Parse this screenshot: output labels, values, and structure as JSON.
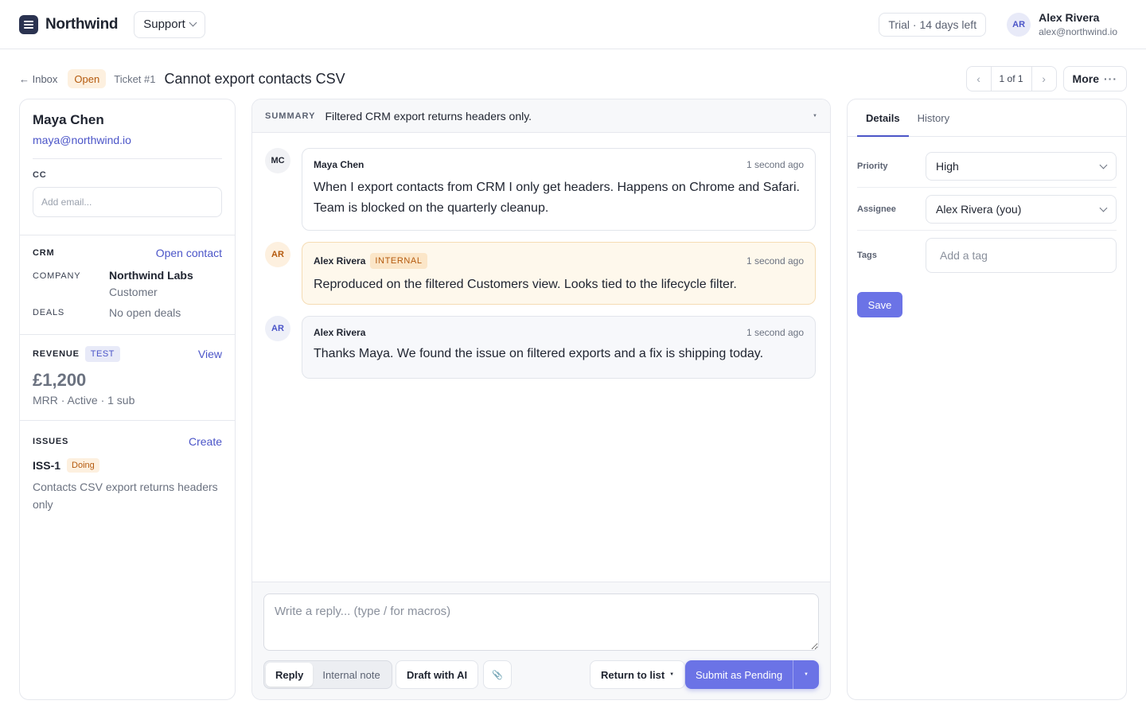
{
  "topbar": {
    "brand": "Northwind",
    "workspace": "Support",
    "trial": "Trial · 14 days left",
    "user": {
      "initials": "AR",
      "name": "Alex Rivera",
      "email": "alex@northwind.io"
    }
  },
  "ticket": {
    "back_label": "← Inbox",
    "status": "Open",
    "number": "Ticket #1",
    "title": "Cannot export contacts CSV",
    "pager": {
      "prev": "‹",
      "count": "1 of 1",
      "next": "›"
    },
    "more_label": "More",
    "more_icon": "···"
  },
  "contact": {
    "name": "Maya Chen",
    "email": "maya@northwind.io",
    "cc_label": "CC",
    "cc_placeholder": "Add email..."
  },
  "crm": {
    "title": "CRM",
    "link": "Open contact",
    "company_label": "COMPANY",
    "company_name": "Northwind Labs",
    "company_type": "Customer",
    "deals_label": "DEALS",
    "deals_value": "No open deals"
  },
  "revenue": {
    "title": "REVENUE",
    "badge": "TEST",
    "link": "View",
    "amount": "£1,200",
    "detail": "MRR · Active · 1 sub"
  },
  "issues": {
    "title": "ISSUES",
    "link": "Create",
    "items": [
      {
        "id": "ISS-1",
        "status": "Doing",
        "text": "Contacts CSV export returns headers only"
      }
    ]
  },
  "summary": {
    "label": "SUMMARY",
    "text": "Filtered CRM export returns headers only.",
    "caret": "▼"
  },
  "messages": [
    {
      "initials": "MC",
      "author": "Maya Chen",
      "time": "1 second ago",
      "body": "When I export contacts from CRM I only get headers. Happens on Chrome and Safari. Team is blocked on the quarterly cleanup."
    },
    {
      "initials": "AR",
      "author": "Alex Rivera",
      "badge": "INTERNAL",
      "time": "1 second ago",
      "body": "Reproduced on the filtered Customers view. Looks tied to the lifecycle filter."
    },
    {
      "initials": "AR",
      "author": "Alex Rivera",
      "time": "1 second ago",
      "body": "Thanks Maya. We found the issue on filtered exports and a fix is shipping today."
    }
  ],
  "composer": {
    "placeholder": "Write a reply... (type / for macros)",
    "mode_reply": "Reply",
    "mode_note": "Internal note",
    "draft_ai": "Draft with AI",
    "attach_icon": "📎",
    "return_label": "Return to list",
    "return_caret": "▼",
    "submit_label": "Submit as Pending",
    "submit_caret": "▼"
  },
  "details": {
    "tab_details": "Details",
    "tab_history": "History",
    "priority_label": "Priority",
    "priority_value": "High",
    "assignee_label": "Assignee",
    "assignee_value": "Alex Rivera (you)",
    "tags_label": "Tags",
    "tags_placeholder": "Add a tag",
    "save_label": "Save"
  },
  "colors": {
    "accent": "#6b73e6",
    "link": "#4b55c8",
    "open_badge_bg": "#fdf0df",
    "internal_bg": "#fef8ec"
  }
}
